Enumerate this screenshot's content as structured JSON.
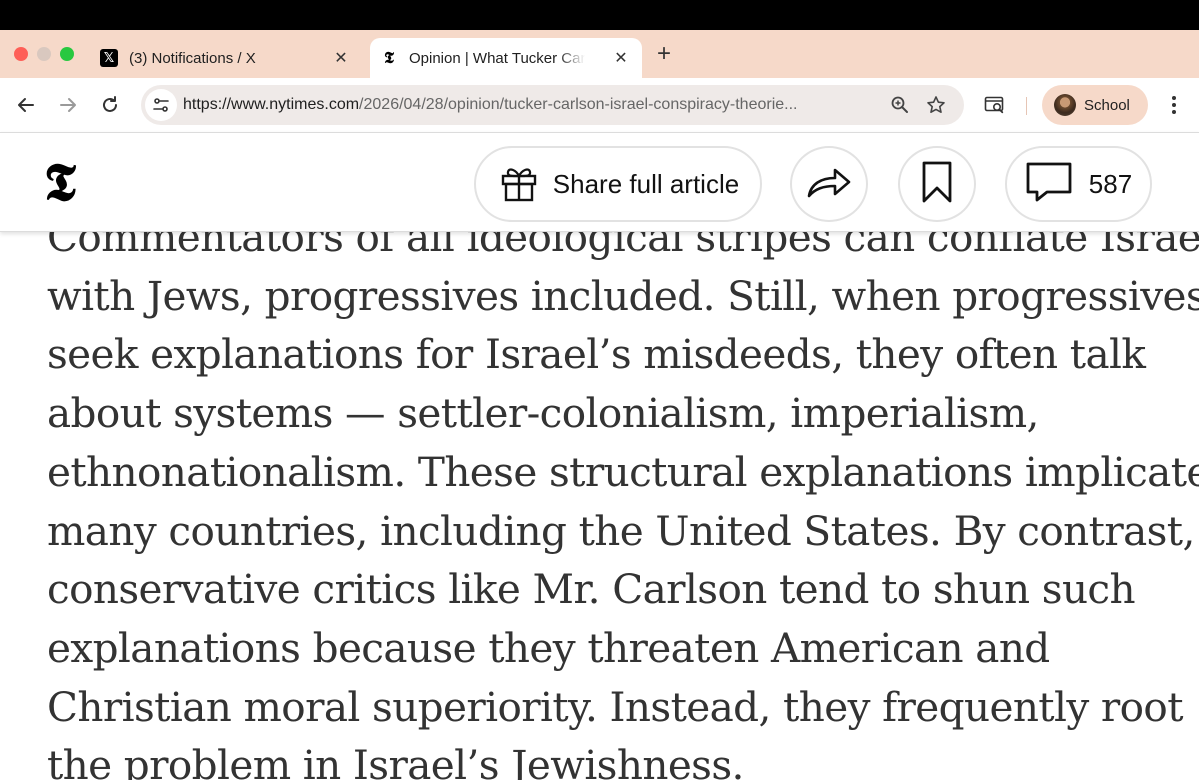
{
  "browser": {
    "tabs": [
      {
        "title": "(3) Notifications / X",
        "favicon": "x-logo-icon",
        "active": false
      },
      {
        "title": "Opinion | What Tucker Carlson Gets Wrong",
        "favicon": "nyt-logo-icon",
        "active": true
      }
    ],
    "address_bar": {
      "url_host": "https://www.nytimes.com",
      "url_path": "/2026/04/28/opinion/tucker-carlson-israel-conspiracy-theorie..."
    },
    "profile": {
      "label": "School"
    },
    "colors": {
      "tabstrip": "#f6d9c9",
      "omnibox": "#efeae8",
      "topbar": "#000000"
    }
  },
  "site_header": {
    "logo": "𝕿",
    "share_full_article_label": "Share full article",
    "comment_count": "587"
  },
  "article": {
    "lines": [
      "Commentators of all ideological stripes can conflate Israel",
      "with Jews, progressives included. Still, when progressives",
      "seek explanations for Israel’s misdeeds, they often talk",
      "about systems — settler-colonialism, imperialism,",
      "ethnonationalism. These structural explanations implicate",
      "many countries, including the United States. By contrast,",
      "conservative critics like Mr. Carlson tend to shun such",
      "explanations because they threaten American and",
      "Christian moral superiority. Instead, they frequently root",
      "the problem in Israel’s Jewishness."
    ]
  }
}
